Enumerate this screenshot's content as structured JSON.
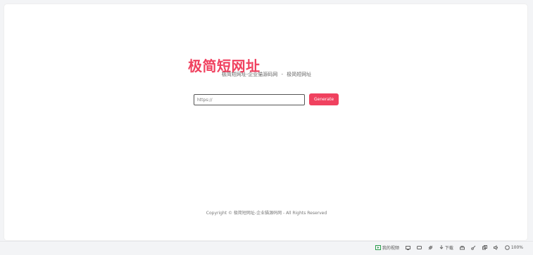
{
  "brand": {
    "title": "极简短网址"
  },
  "subtitle": {
    "left": "极简短网址-企业猫源码网",
    "separator": "-",
    "right": "极简短网址"
  },
  "form": {
    "input_value": "https://",
    "button_label": "Generate"
  },
  "footer": {
    "copyright": "Copyright © 极简短网址-企业猫源码网 - All Rights Reserved"
  },
  "statusbar": {
    "items": [
      {
        "icon": "video-icon",
        "label": "我的视频"
      },
      {
        "icon": "screen-icon",
        "label": ""
      },
      {
        "icon": "chat-icon",
        "label": ""
      },
      {
        "icon": "rocket-icon",
        "label": ""
      },
      {
        "icon": "download-icon",
        "label": "下载"
      },
      {
        "icon": "print-icon",
        "label": ""
      },
      {
        "icon": "cut-icon",
        "label": ""
      },
      {
        "icon": "copy-icon",
        "label": ""
      },
      {
        "icon": "sound-icon",
        "label": ""
      },
      {
        "icon": "zoom-icon",
        "label": "100%"
      }
    ]
  },
  "colors": {
    "accent": "#f0415f",
    "text_muted": "#666666",
    "background": "#ffffff"
  }
}
